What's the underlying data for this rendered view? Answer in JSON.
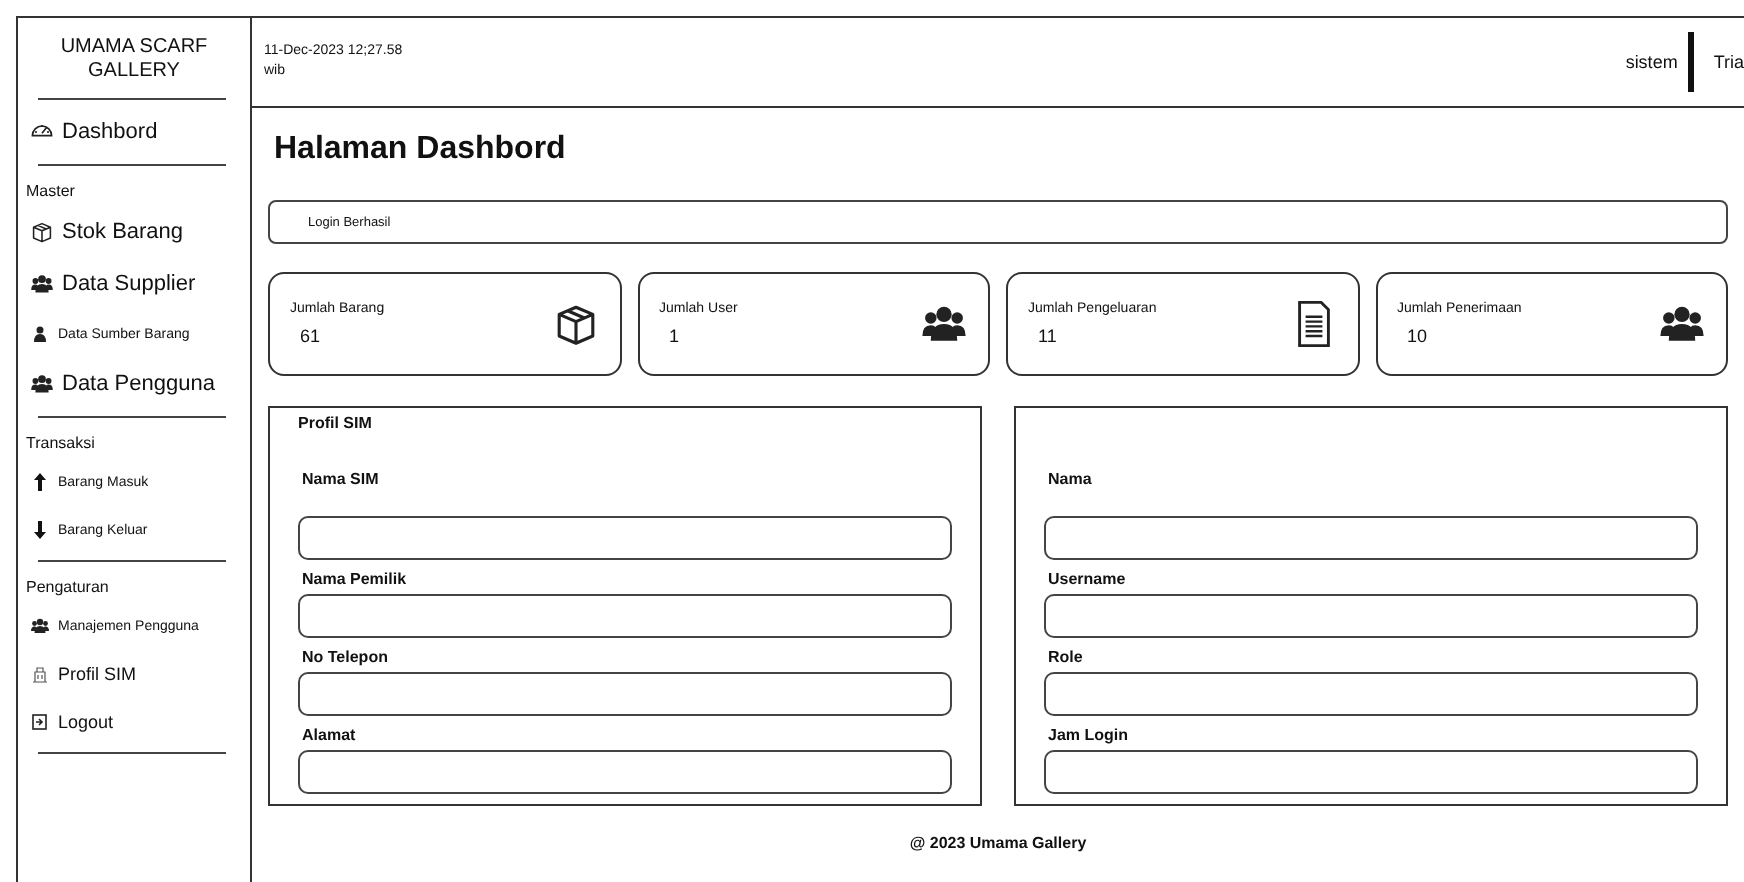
{
  "sidebar": {
    "title": "UMAMA SCARF GALLERY",
    "sections": [
      {
        "items": [
          {
            "label": "Dashbord"
          }
        ]
      },
      {
        "heading": "Master",
        "items": [
          {
            "label": "Stok Barang"
          },
          {
            "label": "Data Supplier"
          },
          {
            "label": "Data Sumber Barang"
          },
          {
            "label": "Data Pengguna"
          }
        ]
      },
      {
        "heading": "Transaksi",
        "items": [
          {
            "label": "Barang Masuk"
          },
          {
            "label": "Barang Keluar"
          }
        ]
      },
      {
        "heading": "Pengaturan",
        "items": [
          {
            "label": "Manajemen Pengguna"
          },
          {
            "label": "Profil SIM"
          },
          {
            "label": "Logout"
          }
        ]
      }
    ]
  },
  "header": {
    "datetime": "11-Dec-2023 12;27.58",
    "timezone": "wib",
    "user_role": "sistem",
    "user_name": "Tria"
  },
  "page_title": "Halaman Dashbord",
  "alert": "Login Berhasil",
  "stats": [
    {
      "label": "Jumlah Barang",
      "value": "61"
    },
    {
      "label": "Jumlah User",
      "value": "1"
    },
    {
      "label": "Jumlah Pengeluaran",
      "value": "11"
    },
    {
      "label": "Jumlah Penerimaan",
      "value": "10"
    }
  ],
  "panels": [
    {
      "title": "Profil SIM",
      "fields": [
        {
          "label": "Nama SIM"
        },
        {
          "label": "Nama Pemilik"
        },
        {
          "label": "No Telepon"
        },
        {
          "label": "Alamat"
        }
      ]
    },
    {
      "fields": [
        {
          "label": "Nama"
        },
        {
          "label": "Username"
        },
        {
          "label": "Role"
        },
        {
          "label": "Jam Login"
        }
      ]
    }
  ],
  "footer": "@ 2023 Umama Gallery"
}
